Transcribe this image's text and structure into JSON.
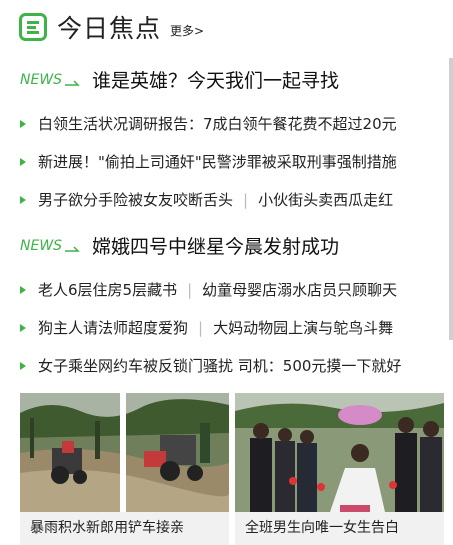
{
  "header": {
    "title": "今日焦点",
    "more": "更多>"
  },
  "news_tag": "NEWS",
  "sections": [
    {
      "headline": "谁是英雄？今天我们一起寻找",
      "items": [
        [
          "白领生活状况调研报告：7成白领午餐花费不超过20元"
        ],
        [
          "新进展！\"偷拍上司通奸\"民警涉罪被采取刑事强制措施"
        ],
        [
          "男子欲分手险被女友咬断舌头",
          "小伙街头卖西瓜走红"
        ]
      ]
    },
    {
      "headline": "嫦娥四号中继星今晨发射成功",
      "items": [
        [
          "老人6层住房5层藏书",
          "幼童母婴店溺水店员只顾聊天"
        ],
        [
          "狗主人请法师超度爱狗",
          "大妈动物园上演与鸵鸟斗舞"
        ],
        [
          "女子乘坐网约车被反锁门骚扰 司机：500元摸一下就好"
        ]
      ]
    }
  ],
  "cards": [
    {
      "caption": "暴雨积水新郎用铲车接亲"
    },
    {
      "caption": "全班男生向唯一女生告白"
    }
  ],
  "colors": {
    "accent": "#3db34a",
    "separator": "#bbbbbb",
    "card_bg": "#f1f1f1"
  }
}
